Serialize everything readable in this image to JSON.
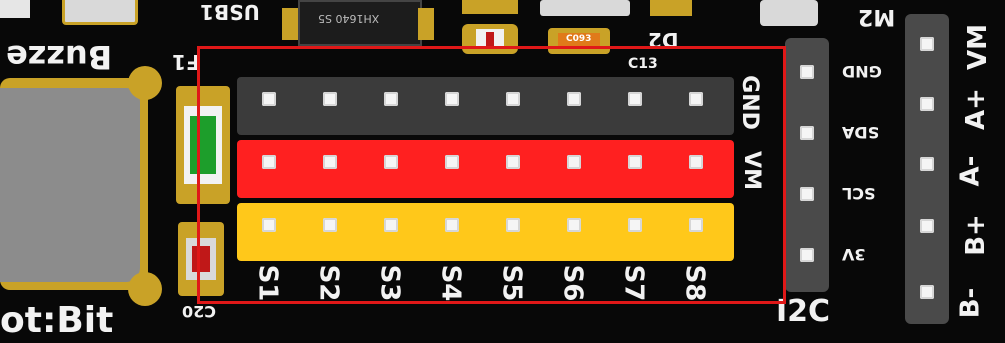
{
  "board": {
    "buzzer_label": "Buzze",
    "fuse_label": "F1",
    "usb_label": "USB1",
    "brand_label": "ot:Bit",
    "c20_label": "C20",
    "c13_label": "C13",
    "d2_label": "D2",
    "m2_label": "M2",
    "chip_marking": "XH1640 S5",
    "smd_marking": "C093"
  },
  "servo_header": {
    "row_labels": [
      "GND",
      "VM"
    ],
    "channels": [
      "S1",
      "S2",
      "S3",
      "S4",
      "S5",
      "S6",
      "S7",
      "S8"
    ],
    "colors": {
      "gnd": "#3b3b3b",
      "vm": "#ff2020",
      "signal": "#ffc81a"
    }
  },
  "i2c_header": {
    "title": "I2C",
    "pins": [
      "GND",
      "SDA",
      "SCL",
      "3V"
    ]
  },
  "motor_header": {
    "labels": [
      "B-",
      "B+",
      "A-",
      "A+",
      "VM"
    ]
  },
  "highlight": {
    "color": "#e01818"
  }
}
